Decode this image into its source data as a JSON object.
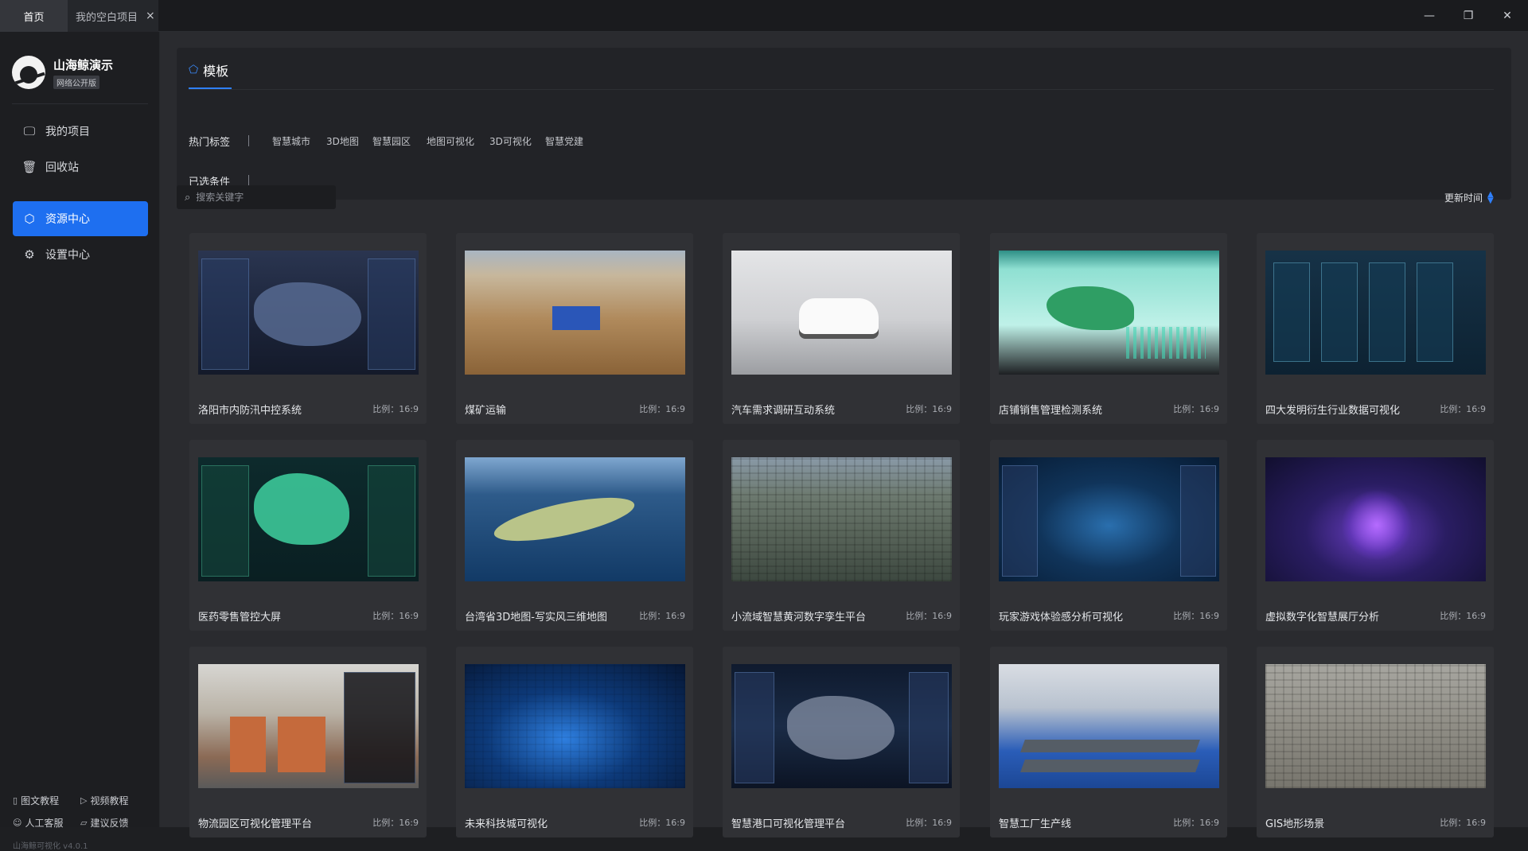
{
  "tabs": [
    {
      "label": "首页"
    },
    {
      "label": "我的空白项目",
      "close": "×"
    }
  ],
  "window_controls": {
    "minimize": "—",
    "restore": "❐",
    "close": "✕"
  },
  "app": {
    "name": "山海鲸演示",
    "edition": "网络公开版",
    "version": "山海鲸可视化 v4.0.1"
  },
  "nav": [
    {
      "label": "我的项目",
      "icon": "monitor-icon"
    },
    {
      "label": "回收站",
      "icon": "trash-icon"
    },
    {
      "label": "资源中心",
      "icon": "cube-icon",
      "active": true
    },
    {
      "label": "设置中心",
      "icon": "gear-icon"
    }
  ],
  "footer_links": [
    {
      "label": "图文教程",
      "icon": "doc-icon"
    },
    {
      "label": "视频教程",
      "icon": "play-icon"
    },
    {
      "label": "人工客服",
      "icon": "user-icon"
    },
    {
      "label": "建议反馈",
      "icon": "feedback-icon"
    }
  ],
  "filter": {
    "title": "模板",
    "hot_tags_label": "热门标签",
    "hot_tags": [
      "智慧城市",
      "3D地图",
      "智慧园区",
      "地图可视化",
      "3D可视化",
      "智慧党建"
    ],
    "selected_label": "已选条件"
  },
  "search": {
    "placeholder": "搜索关键字"
  },
  "sort": {
    "label": "更新时间"
  },
  "templates": [
    {
      "title": "洛阳市内防汛中控系统",
      "ratio": "比例：16:9"
    },
    {
      "title": "煤矿运输",
      "ratio": "比例：16:9"
    },
    {
      "title": "汽车需求调研互动系统",
      "ratio": "比例：16:9"
    },
    {
      "title": "店铺销售管理检测系统",
      "ratio": "比例：16:9"
    },
    {
      "title": "四大发明衍生行业数据可视化",
      "ratio": "比例：16:9"
    },
    {
      "title": "医药零售管控大屏",
      "ratio": "比例：16:9"
    },
    {
      "title": "台湾省3D地图-写实风三维地图",
      "ratio": "比例：16:9"
    },
    {
      "title": "小流域智慧黄河数字孪生平台",
      "ratio": "比例：16:9"
    },
    {
      "title": "玩家游戏体验感分析可视化",
      "ratio": "比例：16:9"
    },
    {
      "title": "虚拟数字化智慧展厅分析",
      "ratio": "比例：16:9"
    },
    {
      "title": "物流园区可视化管理平台",
      "ratio": "比例：16:9"
    },
    {
      "title": "未来科技城可视化",
      "ratio": "比例：16:9"
    },
    {
      "title": "智慧港口可视化管理平台",
      "ratio": "比例：16:9"
    },
    {
      "title": "智慧工厂生产线",
      "ratio": "比例：16:9"
    },
    {
      "title": "GIS地形场景",
      "ratio": "比例：16:9"
    }
  ]
}
